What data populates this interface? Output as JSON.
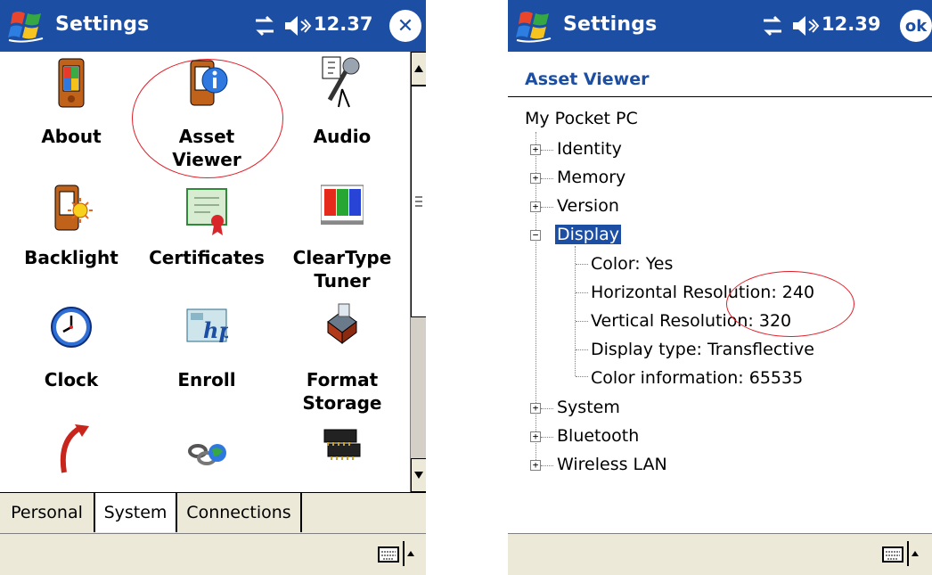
{
  "left": {
    "title": "Settings",
    "clock": "12.37",
    "close_glyph": "✕",
    "icons": [
      {
        "label1": "About",
        "label2": ""
      },
      {
        "label1": "Asset",
        "label2": "Viewer"
      },
      {
        "label1": "Audio",
        "label2": ""
      },
      {
        "label1": "Backlight",
        "label2": ""
      },
      {
        "label1": "Certificates",
        "label2": ""
      },
      {
        "label1": "ClearType",
        "label2": "Tuner"
      },
      {
        "label1": "Clock",
        "label2": ""
      },
      {
        "label1": "Enroll",
        "label2": ""
      },
      {
        "label1": "Format",
        "label2": "Storage"
      }
    ],
    "tabs": [
      "Personal",
      "System",
      "Connections"
    ],
    "active_tab": "System"
  },
  "right": {
    "title": "Settings",
    "clock": "12.39",
    "ok_label": "ok",
    "header": "Asset Viewer",
    "tree": {
      "root": "My Pocket PC",
      "nodes": [
        "Identity",
        "Memory",
        "Version",
        "Display"
      ],
      "display_children": [
        "Color: Yes",
        "Horizontal Resolution: 240",
        "Vertical Resolution: 320",
        "Display type: Transflective",
        "Color information: 65535"
      ],
      "after_nodes": [
        "System",
        "Bluetooth",
        "Wireless LAN"
      ]
    }
  },
  "colors": {
    "titlebar": "#1c4ea3",
    "annotation": "#e0202a",
    "bar_bg": "#ece9d8"
  }
}
